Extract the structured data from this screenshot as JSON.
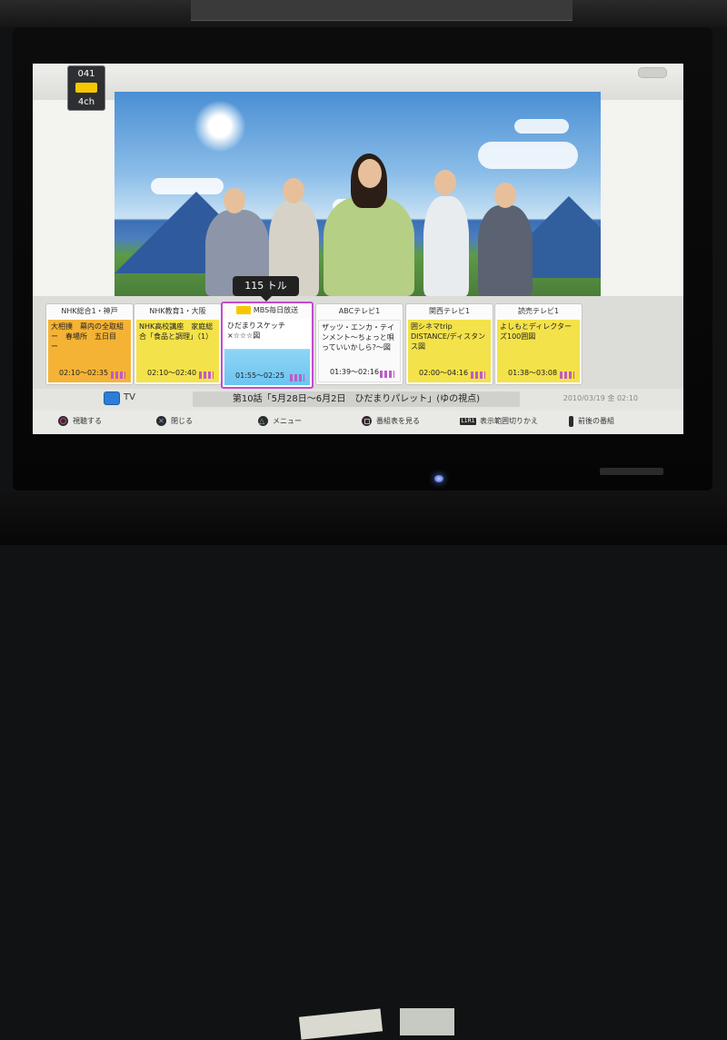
{
  "channel_badge": {
    "number": "041",
    "label": "4ch"
  },
  "tooltip": {
    "text": "115 トル"
  },
  "guide": {
    "cards": [
      {
        "channel": "NHK総合1・神戸",
        "title": "大相撲　幕内の全取組　ー　春場所　五日目　ー",
        "time": "02:10～02:35",
        "color": "orange",
        "has_logo": false
      },
      {
        "channel": "NHK教育1・大阪",
        "title": "NHK高校講座　家庭総合「食品と調理」（1）",
        "time": "02:10～02:40",
        "color": "yellow",
        "has_logo": false
      },
      {
        "channel": "MBS毎日放送",
        "title": "ひだまりスケッチ×☆☆☆図",
        "time": "01:55～02:25",
        "color": "sel",
        "has_logo": true
      },
      {
        "channel": "ABCテレビ1",
        "title": "ザッツ・エンカ・テインメント～ちょっと唄っていいかしら?～図",
        "time": "01:39～02:16",
        "color": "white",
        "has_logo": false
      },
      {
        "channel": "関西テレビ1",
        "title": "囲シネマtrip　DISTANCE/ディスタンス図",
        "time": "02:00～04:16",
        "color": "yellow",
        "has_logo": false
      },
      {
        "channel": "読売テレビ1",
        "title": "よしもとディレクターズ100囲図",
        "time": "01:38～03:08",
        "color": "yellow",
        "has_logo": false
      }
    ]
  },
  "infobar": {
    "tv_label": "TV",
    "episode": "第10話「5月28日～6月2日　ひだまりパレット」(ゆの視点)",
    "datetime": "2010/03/19 金 02:10"
  },
  "controls": {
    "watch": "視聴する",
    "close": "閉じる",
    "menu": "メニュー",
    "view_guide": "番組表を見る",
    "l1": "L1",
    "r1": "R1",
    "switch_range": "表示範囲切りかえ",
    "prev_next": "前後の番組"
  }
}
